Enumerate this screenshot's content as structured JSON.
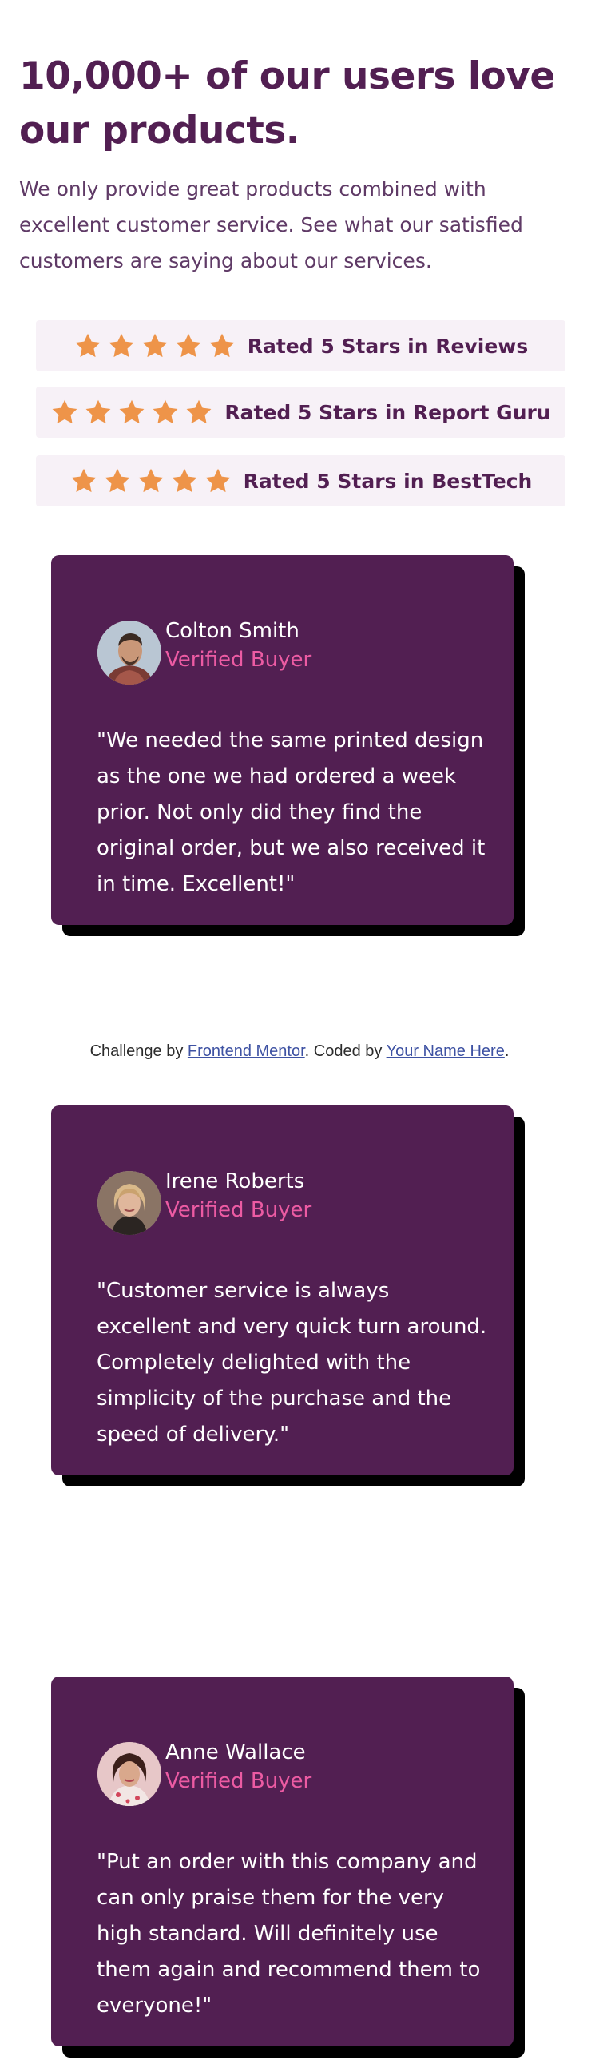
{
  "header": {
    "title": "10,000+ of our users love our products.",
    "intro": "We only provide great products combined with excellent customer service. See what our satisfied customers are saying about our services."
  },
  "ratings": [
    {
      "label": "Rated 5 Stars in Reviews",
      "stars": 5
    },
    {
      "label": "Rated 5 Stars in Report Guru",
      "stars": 5
    },
    {
      "label": "Rated 5 Stars in BestTech",
      "stars": 5
    }
  ],
  "testimonials": [
    {
      "name": "Colton Smith",
      "badge": "Verified Buyer",
      "quote": "\"We needed the same printed design as the one we had ordered a week prior. Not only did they find the original order, but we also received it in time. Excellent!\""
    },
    {
      "name": "Irene Roberts",
      "badge": "Verified Buyer",
      "quote": "\"Customer service is always excellent and very quick turn around. Completely delighted with the simplicity of the purchase and the speed of delivery.\""
    },
    {
      "name": "Anne Wallace",
      "badge": "Verified Buyer",
      "quote": "\"Put an order with this company and can only praise them for the very high standard. Will definitely use them again and recommend them to everyone!\""
    }
  ],
  "attribution": {
    "prefix": "Challenge by ",
    "link1": "Frontend Mentor",
    "middle": ". Coded by ",
    "link2": "Your Name Here",
    "suffix": "."
  },
  "colors": {
    "primary": "#521f52",
    "accent_pink": "#ec5ba3",
    "star_orange": "#ee9449",
    "rating_bg": "#f7f1f7",
    "shadow": "#000000"
  }
}
